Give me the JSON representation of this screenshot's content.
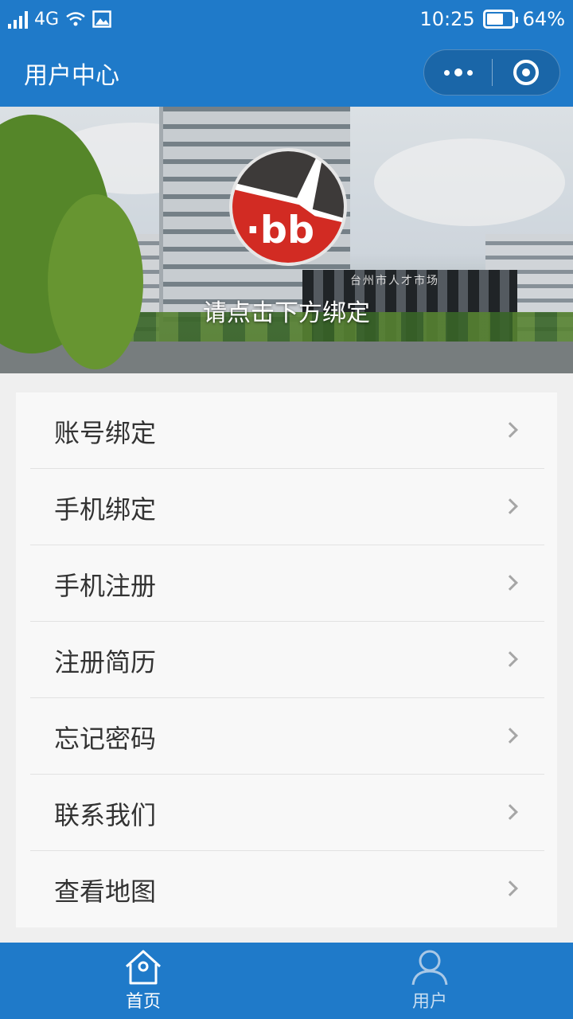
{
  "status_bar": {
    "network": "4G",
    "time": "10:25",
    "battery": "64%"
  },
  "nav": {
    "title": "用户中心"
  },
  "banner": {
    "hint": "请点击下方绑定",
    "sign": "台州市人才市场"
  },
  "menu": {
    "items": [
      {
        "label": "账号绑定"
      },
      {
        "label": "手机绑定"
      },
      {
        "label": "手机注册"
      },
      {
        "label": "注册简历"
      },
      {
        "label": "忘记密码"
      },
      {
        "label": "联系我们"
      },
      {
        "label": "查看地图"
      }
    ]
  },
  "tab_bar": {
    "home_label": "首页",
    "user_label": "用户",
    "active": "首页"
  },
  "colors": {
    "primary": "#1f7ac9",
    "capsule": "#1a66a8",
    "logo_red": "#d22b23"
  }
}
